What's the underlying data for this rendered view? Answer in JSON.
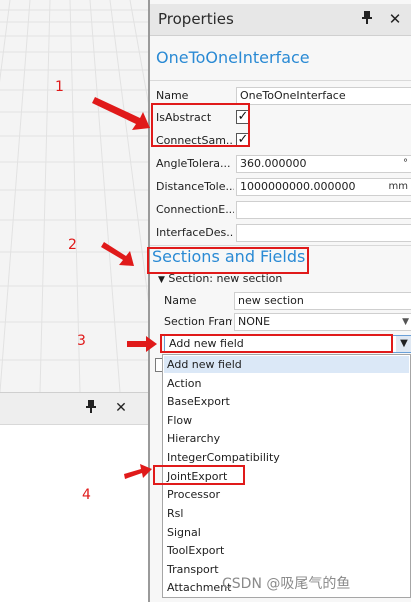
{
  "properties_panel": {
    "title": "Properties",
    "pin_icon": "pin-icon",
    "close_icon": "close-icon",
    "object_name": "OneToOneInterface",
    "fields": [
      {
        "label": "Name",
        "value": "OneToOneInterface",
        "unit": ""
      },
      {
        "label": "AngleTolera...",
        "value": "360.000000",
        "unit": "°"
      },
      {
        "label": "DistanceTole...",
        "value": "1000000000.000000",
        "unit": "mm"
      },
      {
        "label": "ConnectionE...",
        "value": "",
        "unit": ""
      },
      {
        "label": "InterfaceDes...",
        "value": "",
        "unit": ""
      }
    ],
    "checkboxes": [
      {
        "label": "IsAbstract",
        "checked": true
      },
      {
        "label": "ConnectSam...",
        "checked": true
      }
    ]
  },
  "sections": {
    "title": "Sections and Fields",
    "section_header": "Section: new section",
    "name_label": "Name",
    "name_value": "new section",
    "frame_label": "Section Fram",
    "frame_value": "NONE",
    "add_field_placeholder": "Add new field",
    "dropdown_items": [
      "Add new field",
      "Action",
      "BaseExport",
      "Flow",
      "Hierarchy",
      "IntegerCompatibility",
      "JointExport",
      "Processor",
      "Rsl",
      "Signal",
      "ToolExport",
      "Transport",
      "Attachment"
    ]
  },
  "annotations": {
    "numbers": [
      "1",
      "2",
      "3",
      "4"
    ],
    "color": "#e01a1a"
  },
  "watermark": "CSDN @吸尾气的鱼",
  "colors": {
    "accent_blue": "#2a8ad4",
    "panel_bg": "#f7f7f7",
    "selection_bg": "#dbe8f7"
  }
}
